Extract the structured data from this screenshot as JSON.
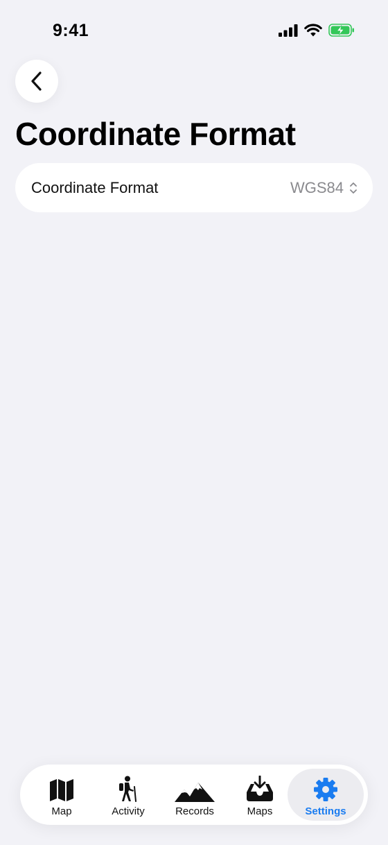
{
  "status_bar": {
    "time": "9:41",
    "icons": [
      "cellular-signal-icon",
      "wifi-icon",
      "battery-charging-icon"
    ],
    "battery_color": "#34c759"
  },
  "header": {
    "back_icon": "chevron-left-icon",
    "title": "Coordinate Format"
  },
  "settings": {
    "rows": [
      {
        "label": "Coordinate Format",
        "value": "WGS84",
        "icon": "chevron-up-down-icon"
      }
    ]
  },
  "tab_bar": {
    "active_color": "#1a7cf0",
    "items": [
      {
        "label": "Map",
        "icon": "map-icon",
        "active": false
      },
      {
        "label": "Activity",
        "icon": "hiker-icon",
        "active": false
      },
      {
        "label": "Records",
        "icon": "mountains-icon",
        "active": false
      },
      {
        "label": "Maps",
        "icon": "tray-download-icon",
        "active": false
      },
      {
        "label": "Settings",
        "icon": "gear-icon",
        "active": true
      }
    ]
  }
}
